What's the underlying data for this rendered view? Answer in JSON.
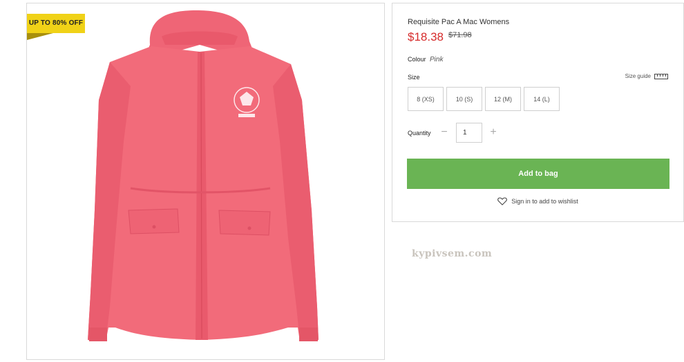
{
  "product": {
    "badge": "UP TO 80% OFF",
    "title": "Requisite Pac A Mac Womens",
    "price": "$18.38",
    "old_price": "$71.98",
    "colour_label": "Colour",
    "colour_value": "Pink",
    "size_label": "Size",
    "size_guide": "Size guide",
    "sizes": [
      "8 (XS)",
      "10 (S)",
      "12 (M)",
      "14 (L)"
    ],
    "quantity_label": "Quantity",
    "quantity_value": "1",
    "add_to_bag": "Add to bag",
    "wishlist": "Sign in to add to wishlist"
  },
  "watermark": "kypivsem.com",
  "colors": {
    "accent_green": "#6ab454",
    "price_red": "#d62b2b",
    "badge_yellow": "#f0d217",
    "jacket_pink": "#f26b7a"
  },
  "icons": {
    "ruler": "ruler-icon",
    "heart": "heart-plus-icon",
    "minus": "minus-icon",
    "plus": "plus-icon"
  }
}
